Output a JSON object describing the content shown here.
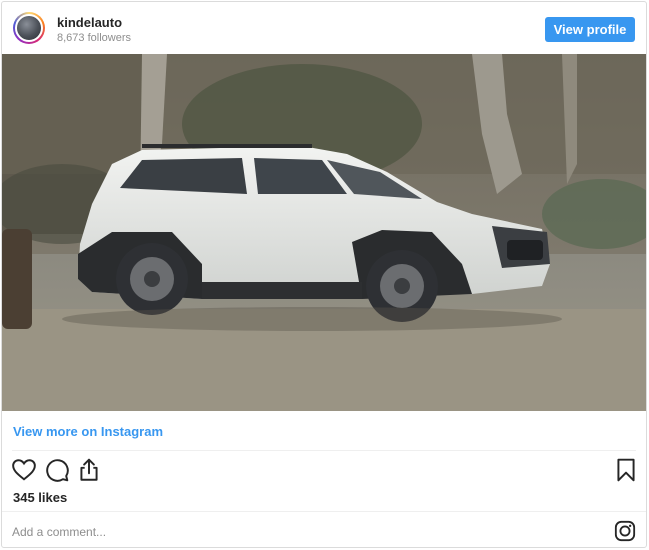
{
  "header": {
    "username": "kindelauto",
    "followers": "8,673 followers",
    "view_profile_label": "View profile"
  },
  "post": {
    "image_icon": "photo-suv",
    "view_more_label": "View more on Instagram",
    "likes": "345 likes",
    "comment_placeholder": "Add a comment...",
    "actions": [
      "heart-icon",
      "comment-icon",
      "share-icon",
      "bookmark-icon"
    ]
  },
  "colors": {
    "accent": "#3897f0",
    "border": "#dbdbdb",
    "muted_text": "#8e8e8e"
  }
}
